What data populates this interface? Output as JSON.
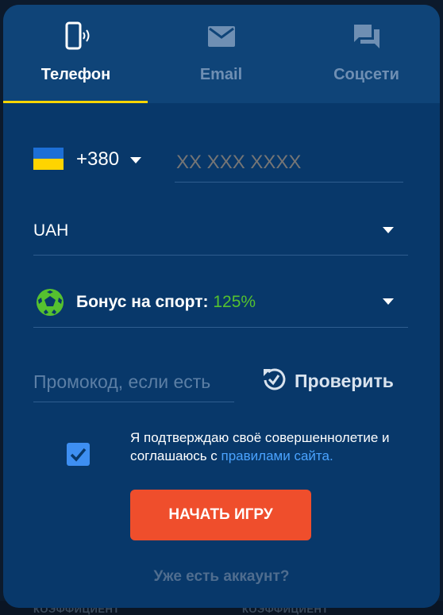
{
  "tabs": [
    {
      "label": "Телефон",
      "icon": "phone-icon"
    },
    {
      "label": "Email",
      "icon": "email-icon"
    },
    {
      "label": "Соцсети",
      "icon": "chat-icon"
    }
  ],
  "phone": {
    "country_code": "+380",
    "placeholder": "XX XXX XXXX",
    "flag": "ukraine-flag"
  },
  "currency": {
    "value": "UAH"
  },
  "bonus": {
    "label": "Бонус на спорт:",
    "value": "125%",
    "icon": "soccer-ball-icon"
  },
  "promo": {
    "placeholder": "Промокод, если есть",
    "check_label": "Проверить"
  },
  "agreement": {
    "checked": true,
    "text": "Я подтверждаю своё совершеннолетие и соглашаюсь с",
    "link": "правилами сайта."
  },
  "start_button": "НАЧАТЬ ИГРУ",
  "login_link": "Уже есть аккаунт?",
  "background": {
    "text": "КОЭФФИЦИЕНТ"
  },
  "colors": {
    "accent": "#f7d500",
    "button": "#ef4e2c",
    "link": "#4aa3ff",
    "bonus": "#55c12f",
    "card": "#08386a"
  }
}
